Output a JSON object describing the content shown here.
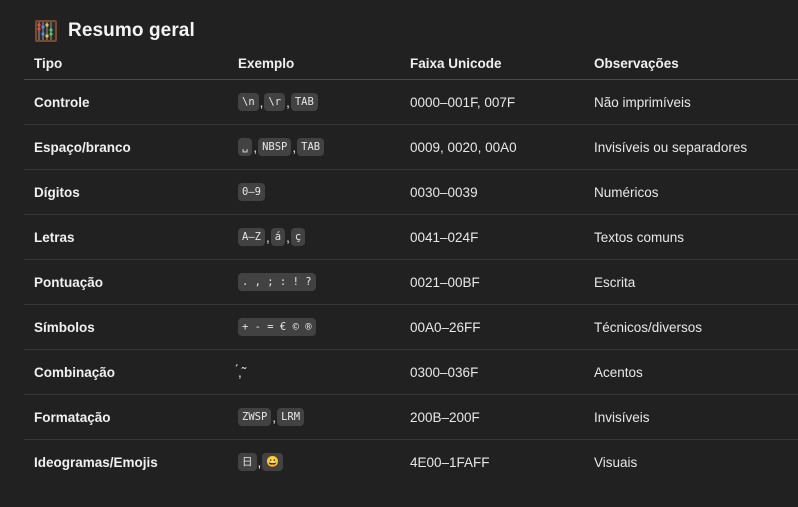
{
  "heading": {
    "icon": "abacus-icon",
    "title": "Resumo geral"
  },
  "table": {
    "headers": [
      "Tipo",
      "Exemplo",
      "Faixa Unicode",
      "Observações"
    ],
    "rows": [
      {
        "tipo": "Controle",
        "exemplo": [
          {
            "t": "code",
            "v": "\\n"
          },
          {
            "t": "sep",
            "v": ","
          },
          {
            "t": "code",
            "v": "\\r"
          },
          {
            "t": "sep",
            "v": ","
          },
          {
            "t": "code",
            "v": "TAB"
          }
        ],
        "faixa": "0000–001F, 007F",
        "obs": "Não imprimíveis"
      },
      {
        "tipo": "Espaço/branco",
        "exemplo": [
          {
            "t": "code",
            "v": "␣"
          },
          {
            "t": "sep",
            "v": ","
          },
          {
            "t": "code",
            "v": "NBSP"
          },
          {
            "t": "sep",
            "v": ","
          },
          {
            "t": "code",
            "v": "TAB"
          }
        ],
        "faixa": "0009, 0020, 00A0",
        "obs": "Invisíveis ou separadores"
      },
      {
        "tipo": "Dígitos",
        "exemplo": [
          {
            "t": "code",
            "v": "0–9"
          }
        ],
        "faixa": "0030–0039",
        "obs": "Numéricos"
      },
      {
        "tipo": "Letras",
        "exemplo": [
          {
            "t": "code",
            "v": "A–Z"
          },
          {
            "t": "sep",
            "v": ","
          },
          {
            "t": "code",
            "v": "á"
          },
          {
            "t": "sep",
            "v": ","
          },
          {
            "t": "code",
            "v": "ç"
          }
        ],
        "faixa": "0041–024F",
        "obs": "Textos comuns"
      },
      {
        "tipo": "Pontuação",
        "exemplo": [
          {
            "t": "code",
            "v": ". , ; : ! ?"
          }
        ],
        "faixa": "0021–00BF",
        "obs": "Escrita"
      },
      {
        "tipo": "Símbolos",
        "exemplo": [
          {
            "t": "code",
            "v": "+ - = € © ®"
          }
        ],
        "faixa": "00A0–26FF",
        "obs": "Técnicos/diversos"
      },
      {
        "tipo": "Combinação",
        "exemplo": [
          {
            "t": "plain",
            "v": "́,̃"
          }
        ],
        "faixa": "0300–036F",
        "obs": "Acentos"
      },
      {
        "tipo": "Formatação",
        "exemplo": [
          {
            "t": "code",
            "v": "ZWSP"
          },
          {
            "t": "sep",
            "v": ","
          },
          {
            "t": "code",
            "v": "LRM"
          }
        ],
        "faixa": "200B–200F",
        "obs": "Invisíveis"
      },
      {
        "tipo": "Ideogramas/Emojis",
        "exemplo": [
          {
            "t": "code",
            "v": "日"
          },
          {
            "t": "sep",
            "v": ","
          },
          {
            "t": "code",
            "v": "😀"
          }
        ],
        "faixa": "4E00–1FAFF",
        "obs": "Visuais"
      }
    ]
  }
}
